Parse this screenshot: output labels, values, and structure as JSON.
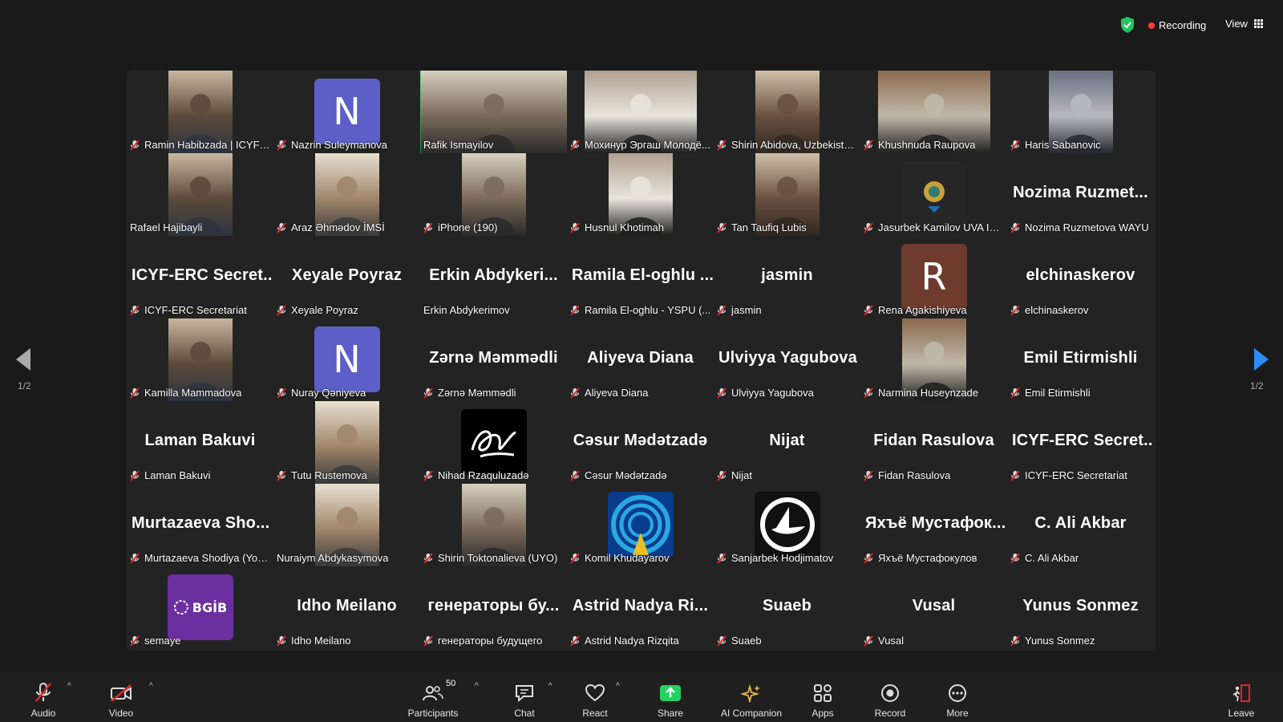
{
  "topbar": {
    "recording_label": "Recording",
    "view_label": "View",
    "recording_color": "#ff3b3b",
    "shield_color": "#22c55e"
  },
  "paging": {
    "left": "1/2",
    "right": "1/2"
  },
  "participants": [
    {
      "name": "Ramin Habibzada | ICYF-E...",
      "kind": "video",
      "muted": true
    },
    {
      "name": "Nazrin Suleymanova",
      "kind": "letter",
      "letter": "N",
      "color": "#5b5fc7",
      "muted": true
    },
    {
      "name": "Rafik Ismayilov",
      "kind": "video",
      "muted": false,
      "active": true
    },
    {
      "name": "Мохинур Эргаш Молодё...",
      "kind": "video",
      "muted": true
    },
    {
      "name": "Shirin Abidova, Uzbekista...",
      "kind": "video",
      "muted": true
    },
    {
      "name": "Khushnuda Raupova",
      "kind": "video",
      "muted": true
    },
    {
      "name": "Haris Sabanovic",
      "kind": "video",
      "muted": true
    },
    {
      "name": "Rafael Hajibayli",
      "kind": "video",
      "muted": false
    },
    {
      "name": "Araz Əhmədov İMSİ",
      "kind": "video",
      "muted": true
    },
    {
      "name": "iPhone (190)",
      "kind": "video",
      "muted": true
    },
    {
      "name": "Husnul Khotimah",
      "kind": "video",
      "muted": true
    },
    {
      "name": "Tan Taufiq Lubis",
      "kind": "video",
      "muted": true
    },
    {
      "name": "Jasurbek Kamilov UVA Int...",
      "kind": "logo",
      "muted": true
    },
    {
      "name": "Nozima Ruzmetova WAYU",
      "kind": "text",
      "display": "Nozima Ruzmet...",
      "muted": true
    },
    {
      "name": "ICYF-ERC Secretariat",
      "kind": "text",
      "display": "ICYF-ERC Secret...",
      "muted": true
    },
    {
      "name": "Xeyale Poyraz",
      "kind": "text",
      "display": "Xeyale Poyraz",
      "muted": true
    },
    {
      "name": "Erkin Abdykerimov",
      "kind": "text",
      "display": "Erkin Abdykeri...",
      "muted": false
    },
    {
      "name": "Ramila El-oghlu - YSPU (...",
      "kind": "text",
      "display": "Ramila El-oghlu ...",
      "muted": true
    },
    {
      "name": "jasmin",
      "kind": "text",
      "display": "jasmin",
      "muted": true
    },
    {
      "name": "Rena Agakishiyeva",
      "kind": "letter",
      "letter": "R",
      "color": "#6e3b2e",
      "muted": true
    },
    {
      "name": "elchinaskerov",
      "kind": "text",
      "display": "elchinaskerov",
      "muted": true
    },
    {
      "name": "Kamilla Mammadova",
      "kind": "video",
      "muted": true
    },
    {
      "name": "Nuray Qəniyeva",
      "kind": "letter",
      "letter": "N",
      "color": "#5b5fc7",
      "muted": true
    },
    {
      "name": "Zərnə Məmmədli",
      "kind": "text",
      "display": "Zərnə Məmmədli",
      "muted": true
    },
    {
      "name": "Aliyeva Diana",
      "kind": "text",
      "display": "Aliyeva Diana",
      "muted": true
    },
    {
      "name": "Ulviyya Yagubova",
      "kind": "text",
      "display": "Ulviyya Yagubova",
      "muted": true
    },
    {
      "name": "Narmina Huseynzade",
      "kind": "video",
      "muted": true
    },
    {
      "name": "Emil Etirmishli",
      "kind": "text",
      "display": "Emil Etirmishli",
      "muted": true
    },
    {
      "name": "Laman Bakuvi",
      "kind": "text",
      "display": "Laman Bakuvi",
      "muted": true
    },
    {
      "name": "Tutu Rustemova",
      "kind": "video",
      "muted": true
    },
    {
      "name": "Nihad Rzaquluzadə",
      "kind": "signature",
      "muted": true
    },
    {
      "name": "Cəsur Mədətzadə",
      "kind": "text",
      "display": "Cəsur Mədətzadə",
      "muted": true
    },
    {
      "name": "Nijat",
      "kind": "text",
      "display": "Nijat",
      "muted": true
    },
    {
      "name": "Fidan Rasulova",
      "kind": "text",
      "display": "Fidan Rasulova",
      "muted": true
    },
    {
      "name": "ICYF-ERC Secretariat",
      "kind": "text",
      "display": "ICYF-ERC Secret...",
      "muted": true
    },
    {
      "name": "Murtazaeva Shodiya (You...",
      "kind": "text",
      "display": "Murtazaeva Sho...",
      "muted": true
    },
    {
      "name": "Nuraiym Abdykasymova",
      "kind": "video",
      "muted": false
    },
    {
      "name": "Shirin Toktonalieva (UYO)",
      "kind": "video",
      "muted": true
    },
    {
      "name": "Komil Khudayarov",
      "kind": "bluelogo",
      "muted": true
    },
    {
      "name": "Sanjarbek Hodjimatov",
      "kind": "boatlogo",
      "muted": true
    },
    {
      "name": "Яхъё Мустафокулов",
      "kind": "text",
      "display": "Яхъё Мустафок...",
      "muted": true
    },
    {
      "name": "C. Ali Akbar",
      "kind": "text",
      "display": "C. Ali Akbar",
      "muted": true
    },
    {
      "name": "semaye",
      "kind": "bgib",
      "logo_text": "BGİB",
      "muted": true
    },
    {
      "name": "Idho Meilano",
      "kind": "text",
      "display": "Idho Meilano",
      "muted": true
    },
    {
      "name": "генераторы будущего",
      "kind": "text",
      "display": "генераторы бу...",
      "muted": true
    },
    {
      "name": "Astrid Nadya Rizqita",
      "kind": "text",
      "display": "Astrid Nadya Ri...",
      "muted": true
    },
    {
      "name": "Suaeb",
      "kind": "text",
      "display": "Suaeb",
      "muted": true
    },
    {
      "name": "Vusal",
      "kind": "text",
      "display": "Vusal",
      "muted": true
    },
    {
      "name": "Yunus Sonmez",
      "kind": "text",
      "display": "Yunus Sonmez",
      "muted": true
    }
  ],
  "toolbar": {
    "audio": "Audio",
    "video": "Video",
    "participants": "Participants",
    "participants_count": "50",
    "chat": "Chat",
    "react": "React",
    "share": "Share",
    "ai_companion": "AI Companion",
    "apps": "Apps",
    "record": "Record",
    "more": "More",
    "leave": "Leave",
    "share_color": "#23d160",
    "muted_color": "#e02828"
  }
}
